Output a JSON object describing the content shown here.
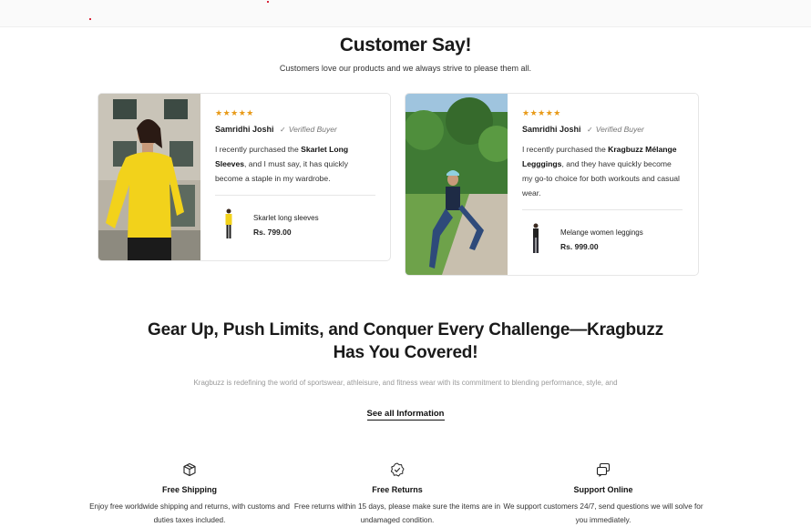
{
  "testimonials": {
    "title": "Customer Say!",
    "subtitle": "Customers love our products and we always strive to please them all.",
    "reviews": [
      {
        "rating_label": "★★★★★",
        "name": "Samridhi Joshi",
        "badge": "Verified Buyer",
        "text_before": "I recently purchased the ",
        "text_bold": "Skarlet Long Sleeves",
        "text_after": ", and I must say, it has quickly become a staple in my wardrobe.",
        "product_name": "Skarlet long sleeves",
        "product_price": "Rs. 799.00"
      },
      {
        "rating_label": "★★★★★",
        "name": "Samridhi Joshi",
        "badge": "Verified Buyer",
        "text_before": "I recently purchased the ",
        "text_bold": "Kragbuzz Mélange Legggings",
        "text_after": ", and they have quickly become my go-to choice for both workouts and casual wear.",
        "product_name": "Melange women leggings",
        "product_price": "Rs. 999.00"
      }
    ]
  },
  "about": {
    "heading": "Gear Up, Push Limits, and Conquer Every Challenge—Kragbuzz Has You Covered!",
    "description": "Kragbuzz is redefining the world of sportswear, athleisure, and fitness wear with its commitment to blending performance, style, and",
    "link_label": "See all Information"
  },
  "features": [
    {
      "icon": "box-icon",
      "title": "Free Shipping",
      "description": "Enjoy free worldwide shipping and returns, with customs and duties taxes included."
    },
    {
      "icon": "badge-check-icon",
      "title": "Free Returns",
      "description": "Free returns within 15 days, please make sure the items are in undamaged condition."
    },
    {
      "icon": "chat-icon",
      "title": "Support Online",
      "description": "We support customers 24/7, send questions we will solve for you immediately."
    }
  ],
  "colors": {
    "star": "#e89a18",
    "text": "#1a1a1a",
    "muted": "#9a9a9a",
    "jersey_yellow": "#f2d21b"
  }
}
